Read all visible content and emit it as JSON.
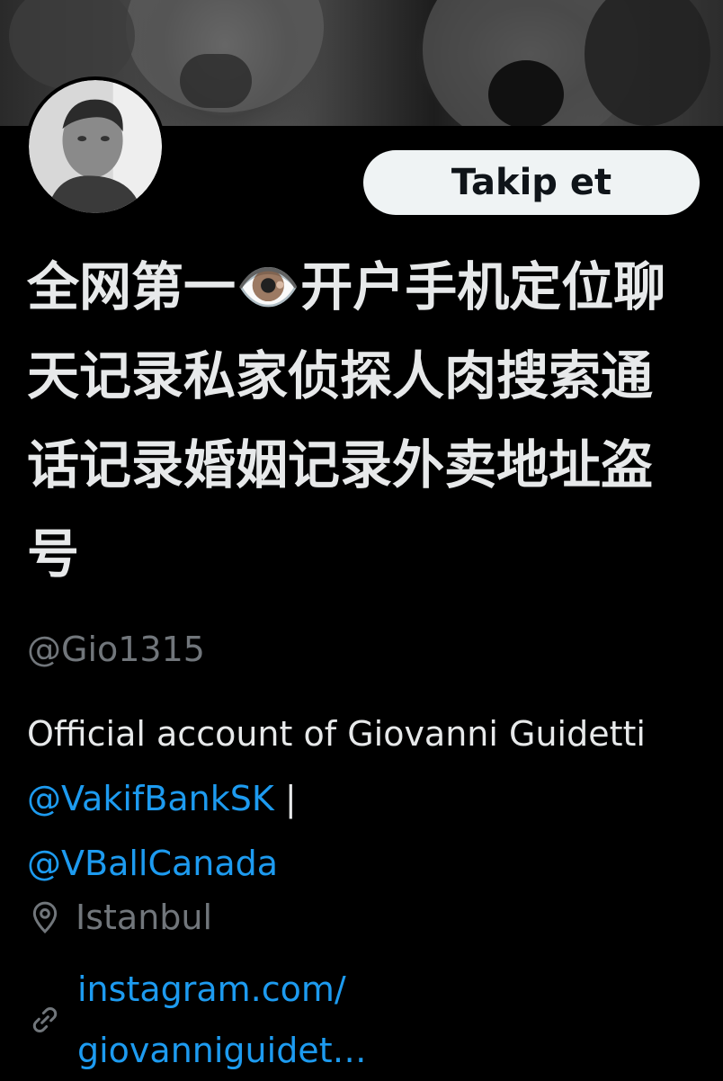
{
  "profile": {
    "display_name": "全网第一👁️开户手机定位聊天记录私家侦探人肉搜索通话记录婚姻记录外卖地址盗号",
    "handle": "@Gio1315",
    "follow_label": "Takip et",
    "bio": {
      "text_part1": "Official account of Giovanni Guidetti ",
      "mention1": "@VakifBankSK",
      "separator": " |",
      "mention2": "@VBallCanada"
    },
    "location": "Istanbul",
    "website": {
      "line1": "instagram.com/",
      "line2": "giovanniguidet…"
    }
  },
  "colors": {
    "background": "#000000",
    "text": "#e7e9ea",
    "muted": "#71767b",
    "link": "#1d9bf0",
    "button_bg": "#eff3f4",
    "button_text": "#0f1419"
  },
  "icons": {
    "location": "map-pin-icon",
    "website": "link-icon"
  }
}
